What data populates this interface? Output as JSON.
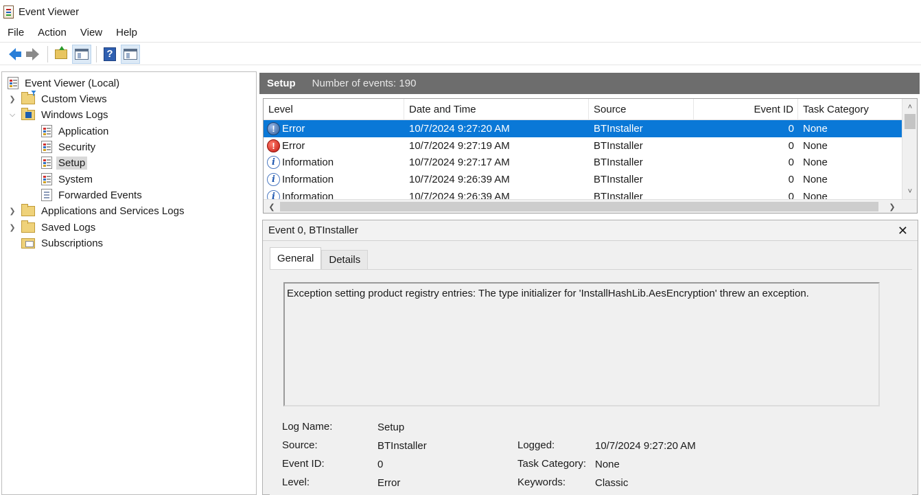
{
  "window": {
    "title": "Event Viewer"
  },
  "menu": [
    "File",
    "Action",
    "View",
    "Help"
  ],
  "toolbar": {
    "icons": [
      "back-arrow-icon",
      "forward-arrow-icon",
      "open-folder-icon",
      "show-hide-tree-icon",
      "help-icon",
      "show-hide-action-pane-icon"
    ]
  },
  "tree": {
    "root": "Event Viewer (Local)",
    "custom_views": "Custom Views",
    "windows_logs": "Windows Logs",
    "application": "Application",
    "security": "Security",
    "setup": "Setup",
    "system": "System",
    "forwarded": "Forwarded Events",
    "apps_services": "Applications and Services Logs",
    "saved_logs": "Saved Logs",
    "subscriptions": "Subscriptions"
  },
  "log_header": {
    "title": "Setup",
    "count": "Number of events: 190"
  },
  "grid": {
    "columns": [
      "Level",
      "Date and Time",
      "Source",
      "Event ID",
      "Task Category"
    ],
    "rows": [
      {
        "level": "Error",
        "datetime": "10/7/2024 9:27:20 AM",
        "source": "BTInstaller",
        "event_id": "0",
        "category": "None"
      },
      {
        "level": "Error",
        "datetime": "10/7/2024 9:27:19 AM",
        "source": "BTInstaller",
        "event_id": "0",
        "category": "None"
      },
      {
        "level": "Information",
        "datetime": "10/7/2024 9:27:17 AM",
        "source": "BTInstaller",
        "event_id": "0",
        "category": "None"
      },
      {
        "level": "Information",
        "datetime": "10/7/2024 9:26:39 AM",
        "source": "BTInstaller",
        "event_id": "0",
        "category": "None"
      },
      {
        "level": "Information",
        "datetime": "10/7/2024 9:26:39 AM",
        "source": "BTInstaller",
        "event_id": "0",
        "category": "None"
      }
    ]
  },
  "detail": {
    "title": "Event 0, BTInstaller",
    "tabs": [
      "General",
      "Details"
    ],
    "message": "Exception setting product registry entries: The type initializer for 'InstallHashLib.AesEncryption' threw an exception.",
    "props": {
      "log_name_label": "Log Name:",
      "log_name": "Setup",
      "source_label": "Source:",
      "source": "BTInstaller",
      "logged_label": "Logged:",
      "logged": "10/7/2024 9:27:20 AM",
      "event_id_label": "Event ID:",
      "event_id": "0",
      "task_category_label": "Task Category:",
      "task_category": "None",
      "level_label": "Level:",
      "level": "Error",
      "keywords_label": "Keywords:",
      "keywords": "Classic"
    }
  }
}
